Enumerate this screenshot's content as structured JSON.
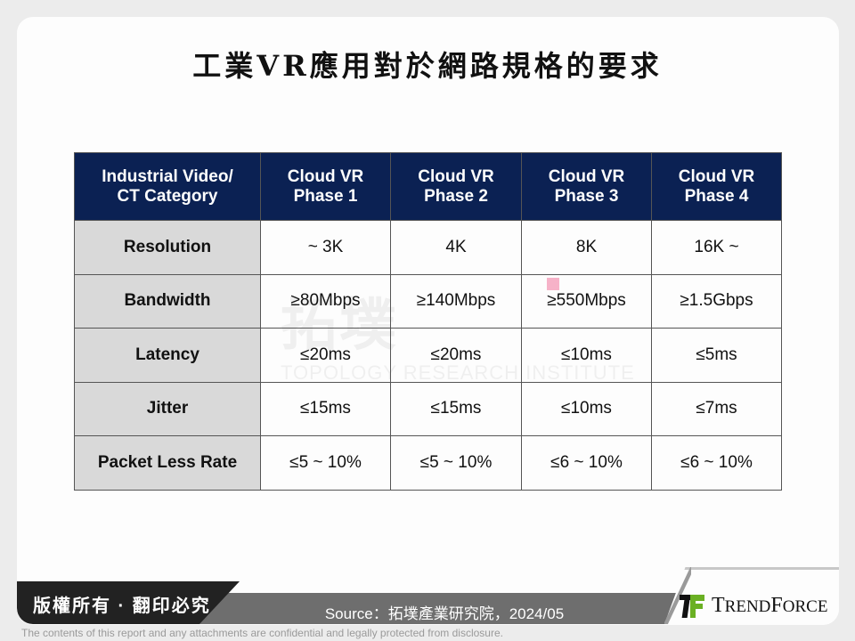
{
  "title": "工業VR應用對於網路規格的要求",
  "table": {
    "headers": [
      [
        "Industrial Video/",
        "CT Category"
      ],
      [
        "Cloud VR",
        "Phase 1"
      ],
      [
        "Cloud VR",
        "Phase 2"
      ],
      [
        "Cloud VR",
        "Phase 3"
      ],
      [
        "Cloud VR",
        "Phase 4"
      ]
    ],
    "rows": [
      {
        "label": "Resolution",
        "values": [
          "~ 3K",
          "4K",
          "8K",
          "16K ~"
        ]
      },
      {
        "label": "Bandwidth",
        "values": [
          "≥80Mbps",
          "≥140Mbps",
          "≥550Mbps",
          "≥1.5Gbps"
        ]
      },
      {
        "label": "Latency",
        "values": [
          "≤20ms",
          "≤20ms",
          "≤10ms",
          "≤5ms"
        ]
      },
      {
        "label": "Jitter",
        "values": [
          "≤15ms",
          "≤15ms",
          "≤10ms",
          "≤7ms"
        ]
      },
      {
        "label": "Packet Less Rate",
        "values": [
          "≤5 ~ 10%",
          "≤5 ~ 10%",
          "≤6 ~ 10%",
          "≤6 ~ 10%"
        ]
      }
    ]
  },
  "watermark": {
    "chinese": "拓墣",
    "english": "TOPOLOGY RESEARCH INSTITUTE"
  },
  "footer": {
    "copyright": "版權所有 · 翻印必究",
    "source": "Source：拓墣產業研究院，2024/05",
    "logo_text_first": "T",
    "logo_text_rest1": "REND",
    "logo_text_mid": "F",
    "logo_text_rest2": "ORCE",
    "disclaimer": "The contents of this report and any attachments are confidential and legally protected from disclosure."
  },
  "colors": {
    "header_bg": "#0b2153",
    "rowhead_bg": "#d9d9d9",
    "logo_green": "#6ab023"
  }
}
